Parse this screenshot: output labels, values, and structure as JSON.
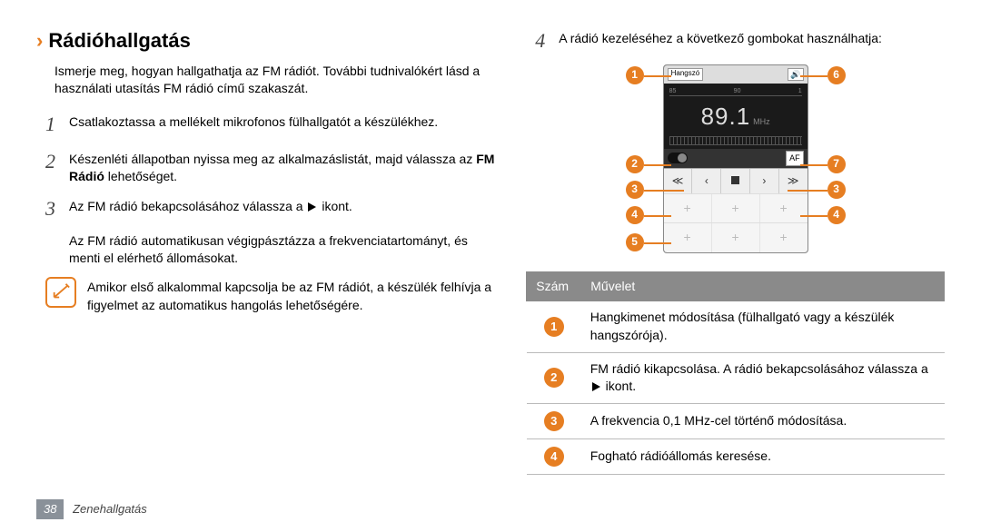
{
  "section": {
    "title": "Rádióhallgatás",
    "intro": "Ismerje meg, hogyan hallgathatja az FM rádiót. További tudnivalókért lásd a használati utasítás FM rádió című szakaszát."
  },
  "steps": {
    "s1": {
      "num": "1",
      "text": "Csatlakoztassa a mellékelt mikrofonos fülhallgatót a készülékhez."
    },
    "s2": {
      "num": "2",
      "text_a": "Készenléti állapotban nyissa meg az alkalmazáslistát, majd válassza az ",
      "bold": "FM Rádió",
      "text_b": " lehetőséget."
    },
    "s3": {
      "num": "3",
      "text_a": "Az FM rádió bekapcsolásához válassza a ",
      "text_b": " ikont.",
      "sub": "Az FM rádió automatikusan végigpásztázza a frekvenciatartományt, és menti el elérhető állomásokat."
    },
    "s4": {
      "num": "4",
      "text": "A rádió kezeléséhez a következő gombokat használhatja:"
    }
  },
  "note": "Amikor első alkalommal kapcsolja be az FM rádiót, a készülék felhívja a figyelmet az automatikus hangolás lehetőségére.",
  "radio": {
    "top_left": "Hangszó",
    "af": "AF",
    "scale_labels": [
      "85",
      "90",
      "1"
    ],
    "freq": "89.1",
    "freq_unit": "MHz",
    "controls": [
      "≪",
      "‹",
      "■",
      "›",
      "≫"
    ]
  },
  "callouts": {
    "c1": "1",
    "c2": "2",
    "c3": "3",
    "c4": "4",
    "c5": "5",
    "c6": "6",
    "c7": "7",
    "c3r": "3",
    "c4r": "4"
  },
  "table": {
    "head_num": "Szám",
    "head_op": "Művelet",
    "rows": [
      {
        "num": "1",
        "text": "Hangkimenet módosítása (fülhallgató vagy a készülék hangszórója)."
      },
      {
        "num": "2",
        "text_a": "FM rádió kikapcsolása. A rádió bekapcsolásához válassza a ",
        "text_b": " ikont."
      },
      {
        "num": "3",
        "text": "A frekvencia 0,1 MHz-cel történő módosítása."
      },
      {
        "num": "4",
        "text": "Fogható rádióállomás keresése."
      }
    ]
  },
  "footer": {
    "page": "38",
    "section": "Zenehallgatás"
  }
}
